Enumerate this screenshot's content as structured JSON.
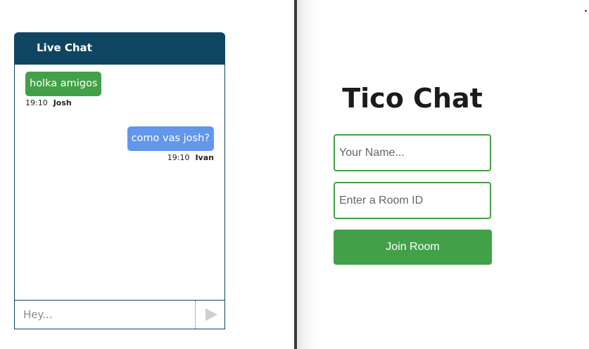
{
  "chat": {
    "title": "Live Chat",
    "messages": [
      {
        "text": "holka amigos",
        "time": "19:10",
        "author": "Josh"
      },
      {
        "text": "como vas josh?",
        "time": "19:10",
        "author": "Ivan"
      }
    ],
    "input_placeholder": "Hey...",
    "send_icon": "send-icon"
  },
  "join": {
    "title": "Tico Chat",
    "name_placeholder": "Your Name...",
    "room_placeholder": "Enter a Room ID",
    "button_label": "Join Room"
  },
  "colors": {
    "header": "#104562",
    "accent_green": "#42a048",
    "bubble_blue": "#6496ec"
  }
}
